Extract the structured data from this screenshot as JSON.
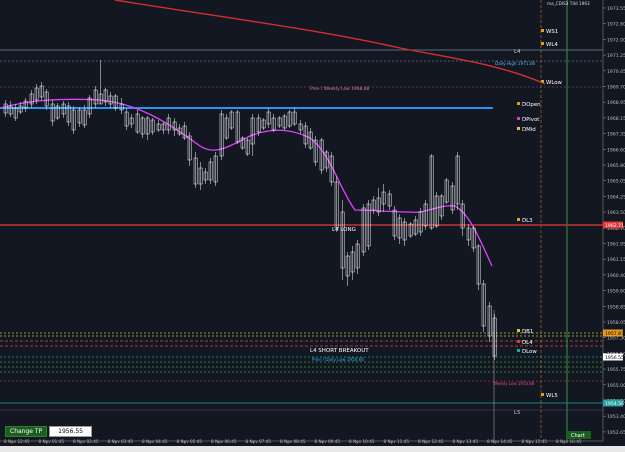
{
  "chart": {
    "top_label": "ma_CDIS3 T4d 1963",
    "price_ticks": [
      "1973.55",
      "1972.80",
      "1972.00",
      "1971.25",
      "1970.45",
      "1969.70",
      "1968.95",
      "1968.15",
      "1967.35",
      "1966.60",
      "1965.80",
      "1965.05",
      "1964.25",
      "1963.50",
      "1962.70",
      "1961.95",
      "1961.15",
      "1960.40",
      "1959.60",
      "1958.85",
      "1958.05",
      "1957.30",
      "1956.50",
      "1955.75",
      "1955.00",
      "1954.20",
      "1953.40",
      "1952.65",
      "1951.90"
    ],
    "time_ticks": [
      "8 Nov 22:45",
      "8 Nov 01:45",
      "8 Nov 02:45",
      "8 Nov 03:45",
      "8 Nov 04:45",
      "8 Nov 05:45",
      "8 Nov 06:45",
      "8 Nov 07:45",
      "8 Nov 08:45",
      "8 Nov 09:45",
      "8 Nov 10:45",
      "8 Nov 11:45",
      "8 Nov 12:45",
      "8 Nov 13:45",
      "8 Nov 14:45",
      "8 Nov 15:45",
      "8 Nov 16:45"
    ],
    "right_tags": {
      "dl3": "1962.71",
      "tag_a": "1957.87",
      "tag_b": "1956.55",
      "tag_c": "1954.56",
      "bottom": "Chart"
    },
    "level_labels": {
      "ws1": "WS1",
      "wl4": "WL4",
      "l4": "L4",
      "daily_high": "Daily High 1971.06",
      "wlow": "WLow",
      "prev_weekly_low": "Prev / Weekly Low 1968.88",
      "dopen": "DOpen",
      "dpivot": "DPivot",
      "dmid": "DMid",
      "dl3": "DL3",
      "l4_long": "L4 LONG",
      "db1": "DB1",
      "dl4": "DL4",
      "dlow": "DLow",
      "l4_short": "L4 SHORT BREAKOUT",
      "prev_daily_low": "Prev / Daily Low 1956.66",
      "weekly_low": "Weekly Low 1954.88",
      "wl5": "WL5",
      "l5": "L5"
    },
    "colors": {
      "background": "#131722",
      "bull": "#ffffff",
      "bear": "#ffffff",
      "ma_red": "#d32f2f",
      "ma_magenta": "#e040fb",
      "dopen_line": "#2196f3",
      "dl3_line": "#e53935",
      "green_line": "#2e7d32"
    }
  },
  "change_tp": {
    "label": "Change TP",
    "value": "1956.55"
  }
}
